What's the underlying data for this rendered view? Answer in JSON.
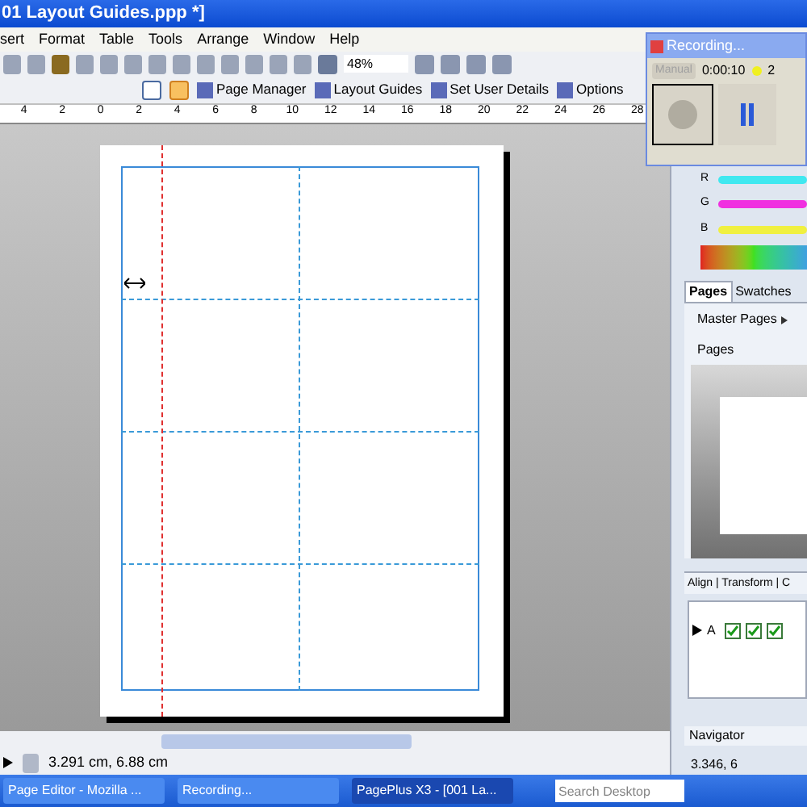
{
  "window": {
    "title": "01 Layout Guides.ppp *]"
  },
  "menu": [
    "sert",
    "Format",
    "Table",
    "Tools",
    "Arrange",
    "Window",
    "Help"
  ],
  "toolbar": {
    "zoom": "48%"
  },
  "toolbar2": [
    "Page Manager",
    "Layout Guides",
    "Set User Details",
    "Options"
  ],
  "ruler": [
    "4",
    "2",
    "0",
    "2",
    "4",
    "6",
    "8",
    "10",
    "12",
    "14",
    "16",
    "18",
    "20",
    "22",
    "24",
    "26",
    "28"
  ],
  "recording": {
    "title": "Recording...",
    "mode": "Manual",
    "time": "0:00:10",
    "count": "2"
  },
  "colour": {
    "channels": [
      {
        "label": "R",
        "color": "#40e8f0"
      },
      {
        "label": "G",
        "color": "#f030e0"
      },
      {
        "label": "B",
        "color": "#f0f040"
      }
    ]
  },
  "pages_panel": {
    "tabs": [
      {
        "label": "Pages",
        "selected": true
      },
      {
        "label": "Swatches",
        "selected": false
      }
    ],
    "master_pages": "Master Pages",
    "pages": "Pages"
  },
  "layers_panel": {
    "title": "Align | Transform | C",
    "rows": [
      {
        "name": "A",
        "checks": [
          true,
          true,
          true
        ]
      }
    ]
  },
  "navigator": "Navigator",
  "status": {
    "position": "3.291 cm, 6.88 cm",
    "right": "3.346, 6"
  },
  "taskbar": {
    "tasks": [
      {
        "label": "Page Editor - Mozilla ...",
        "selected": false
      },
      {
        "label": "Recording...",
        "selected": false
      },
      {
        "label": "PagePlus X3 - [001 La...",
        "selected": true
      }
    ],
    "search": {
      "placeholder": "Search Desktop"
    }
  }
}
